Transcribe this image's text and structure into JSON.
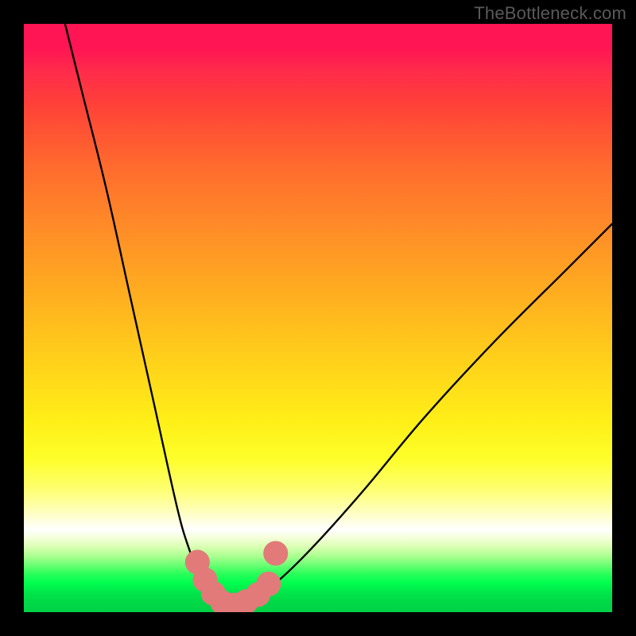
{
  "watermark": "TheBottleneck.com",
  "colors": {
    "frame": "#000000",
    "curve": "#000000",
    "marker_fill": "#e27a7a",
    "marker_stroke": "#e27a7a"
  },
  "chart_data": {
    "type": "line",
    "title": "",
    "xlabel": "",
    "ylabel": "",
    "xlim": [
      0,
      100
    ],
    "ylim": [
      0,
      100
    ],
    "series": [
      {
        "name": "bottleneck-curve",
        "x": [
          7,
          10,
          14,
          18,
          22,
          26,
          28,
          30,
          32,
          33.5,
          35,
          37,
          40,
          44,
          50,
          58,
          68,
          80,
          92,
          100
        ],
        "y": [
          100,
          88,
          72,
          54,
          36,
          18,
          11,
          6,
          3,
          1.5,
          1,
          1.5,
          3,
          6,
          12,
          21,
          33,
          46,
          58,
          66
        ]
      }
    ],
    "markers": {
      "name": "highlight-points",
      "points": [
        {
          "x": 29.5,
          "y": 8.5
        },
        {
          "x": 30.8,
          "y": 5.5
        },
        {
          "x": 32.2,
          "y": 3.2
        },
        {
          "x": 33.8,
          "y": 1.6
        },
        {
          "x": 35.8,
          "y": 1.2
        },
        {
          "x": 37.8,
          "y": 1.8
        },
        {
          "x": 39.8,
          "y": 3.0
        },
        {
          "x": 41.6,
          "y": 4.8
        },
        {
          "x": 42.8,
          "y": 10.0
        }
      ],
      "radius_data_units": 2.1
    },
    "background_gradient": {
      "orientation": "vertical",
      "description": "red (top) → orange → yellow → pale → white → green (bottom)",
      "stops": [
        {
          "pos": 0.0,
          "color": "#ff1454"
        },
        {
          "pos": 0.24,
          "color": "#ff6a2e"
        },
        {
          "pos": 0.58,
          "color": "#ffd31a"
        },
        {
          "pos": 0.86,
          "color": "#ffffff"
        },
        {
          "pos": 1.0,
          "color": "#00d246"
        }
      ]
    }
  }
}
